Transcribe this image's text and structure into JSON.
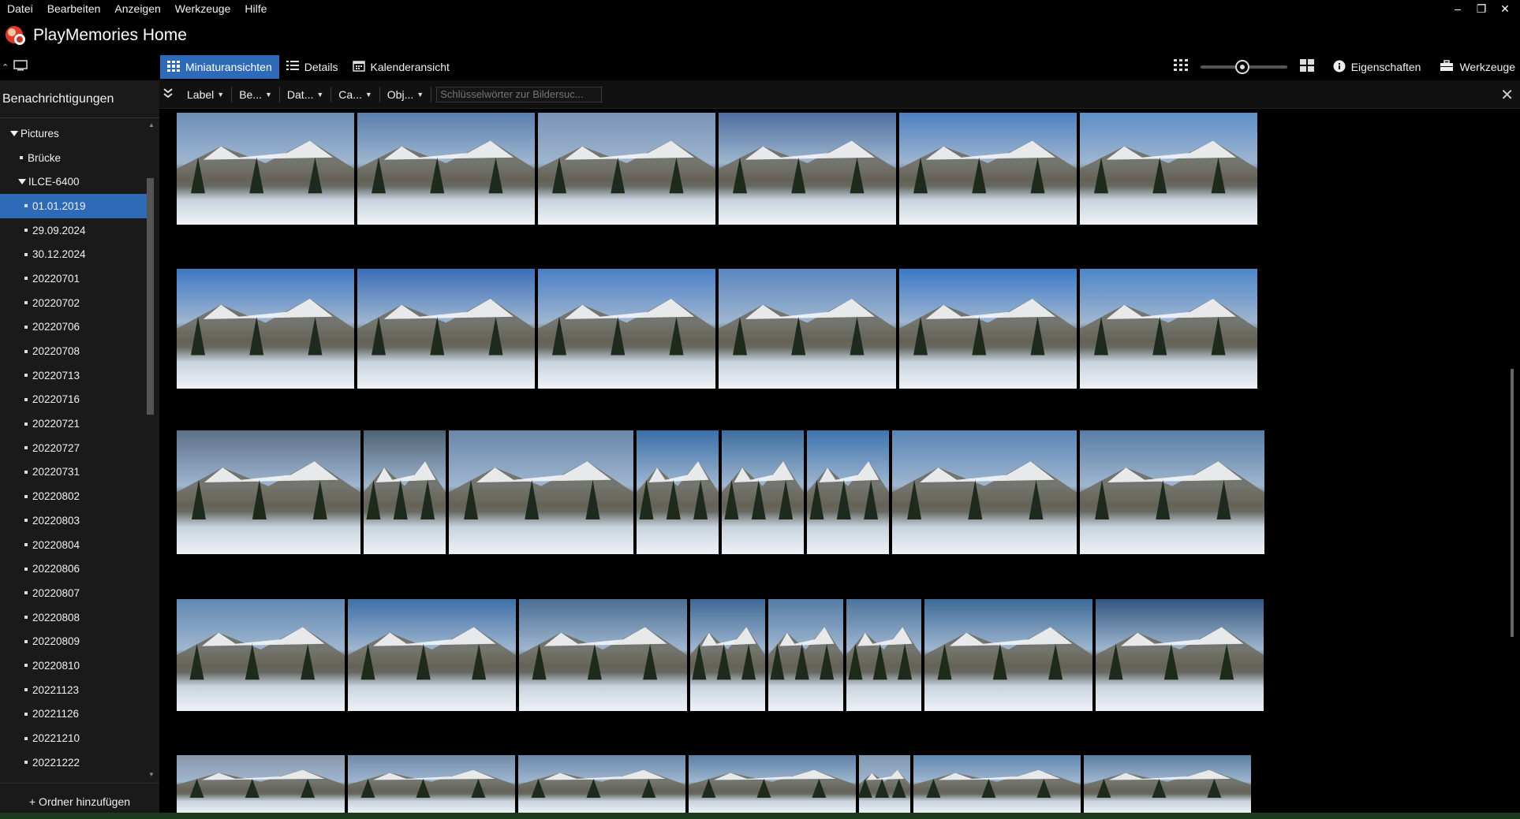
{
  "menu": [
    "Datei",
    "Bearbeiten",
    "Anzeigen",
    "Werkzeuge",
    "Hilfe"
  ],
  "app": {
    "title": "PlayMemories Home"
  },
  "toolbar": {
    "tabs": [
      "Miniaturansichten",
      "Details",
      "Kalenderansicht"
    ],
    "active_tab": "Miniaturansichten",
    "properties_label": "Eigenschaften",
    "tools_label": "Werkzeuge",
    "zoom_level": 0.48
  },
  "sidebar": {
    "notifications_label": "Benachrichtigungen",
    "tree": [
      {
        "label": "Pictures",
        "level": 0,
        "expanded": true
      },
      {
        "label": "Brücke",
        "level": 1
      },
      {
        "label": "ILCE-6400",
        "level": 1,
        "expanded": true
      },
      {
        "label": "01.01.2019",
        "level": 2,
        "selected": true
      },
      {
        "label": "29.09.2024",
        "level": 2
      },
      {
        "label": "30.12.2024",
        "level": 2
      },
      {
        "label": "20220701",
        "level": 2
      },
      {
        "label": "20220702",
        "level": 2
      },
      {
        "label": "20220706",
        "level": 2
      },
      {
        "label": "20220708",
        "level": 2
      },
      {
        "label": "20220713",
        "level": 2
      },
      {
        "label": "20220716",
        "level": 2
      },
      {
        "label": "20220721",
        "level": 2
      },
      {
        "label": "20220727",
        "level": 2
      },
      {
        "label": "20220731",
        "level": 2
      },
      {
        "label": "20220802",
        "level": 2
      },
      {
        "label": "20220803",
        "level": 2
      },
      {
        "label": "20220804",
        "level": 2
      },
      {
        "label": "20220806",
        "level": 2
      },
      {
        "label": "20220807",
        "level": 2
      },
      {
        "label": "20220808",
        "level": 2
      },
      {
        "label": "20220809",
        "level": 2
      },
      {
        "label": "20220810",
        "level": 2
      },
      {
        "label": "20221123",
        "level": 2
      },
      {
        "label": "20221126",
        "level": 2
      },
      {
        "label": "20221210",
        "level": 2
      },
      {
        "label": "20221222",
        "level": 2
      }
    ],
    "add_folder_label": "+ Ordner hinzufügen"
  },
  "filterbar": {
    "filters": [
      "Label",
      "Be...",
      "Dat...",
      "Ca...",
      "Obj..."
    ],
    "search_placeholder": "Schlüsselwörter zur Bildersuc..."
  },
  "colors": {
    "accent": "#2e6ab8",
    "sidebar_bg": "#1a1a1a",
    "background": "#000000"
  },
  "thumbnail_rows": [
    [
      "#6e8fb8",
      "#5a7fae",
      "#7a92b5",
      "#4e6f9e",
      "#4d7fc0",
      "#5d8ec8"
    ],
    [
      "#3f78c2",
      "#3a6eb8",
      "#4a7fc6",
      "#5a86bf",
      "#3b78c8",
      "#4e86c8"
    ],
    [
      "#5d7088",
      "#4e6274",
      "#6a86a8",
      "#3a6ea8",
      "#3e6fa0",
      "#3f74ae",
      "#5a86b6",
      "#587ea6"
    ],
    [
      "#5f88b0",
      "#3e6fa8",
      "#4a6e92",
      "#3e6894",
      "#557ca6",
      "#4c739c",
      "#3d6a98",
      "#33557e"
    ],
    [
      "#8a98a8",
      "#6f8aa6",
      "#6988a8",
      "#5b7fa4",
      "#7e96ae",
      "#5f86ae",
      "#5a7ea0"
    ]
  ]
}
